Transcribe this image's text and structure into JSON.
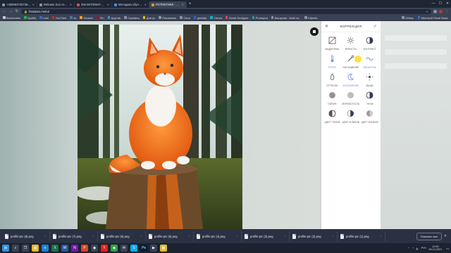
{
  "browser": {
    "tabs": [
      {
        "title": "+40696372673696742057611",
        "favicon_color": "#8a94a8",
        "active": false
      },
      {
        "title": "Release Soci release 21.12.06 (in ...",
        "favicon_color": "#8a94a8",
        "active": false
      },
      {
        "title": "305 МАТЕМАТИКА_ОЛ.pdf",
        "favicon_color": "#d9534f",
        "active": false
      },
      {
        "title": "Методика обучения математи...",
        "favicon_color": "#4a90d9",
        "active": false
      },
      {
        "title": "FOTOSTARS - Фоторедактор о...",
        "favicon_color": "#f39c12",
        "active": true
      }
    ],
    "new_tab": "+",
    "window_controls": [
      "—",
      "☐",
      "✕"
    ],
    "url": "fotostars.me/ru/"
  },
  "bookmarks": {
    "left": [
      {
        "label": "Bookmarks",
        "color": "#c8cfdb"
      },
      {
        "label": "Spotify",
        "color": "#1db954"
      },
      {
        "label": "mail",
        "color": "#2f6fdb"
      },
      {
        "label": "YouTube",
        "color": "#e62117"
      },
      {
        "label": "vk",
        "color": "#4a76a8"
      },
      {
        "label": "Scratch",
        "color": "#f7a41d"
      },
      {
        "label": "Pin",
        "color": "#bd081c"
      },
      {
        "label": "ApyLab",
        "color": "#4a90d9"
      },
      {
        "label": "Сервисы",
        "color": "#8a94a8"
      },
      {
        "label": "Для уч",
        "color": "#f1c40f"
      },
      {
        "label": "Рисование",
        "color": "#8a94a8"
      },
      {
        "label": "Своя",
        "color": "#8a94a8"
      },
      {
        "label": "genially",
        "color": "#2d62f0"
      },
      {
        "label": "Canva",
        "color": "#00c4cc"
      },
      {
        "label": "Gravit Designer",
        "color": "#e84b4b"
      },
      {
        "label": "Photopea",
        "color": "#18a497"
      },
      {
        "label": "Выгрузка - Мой на...",
        "color": "#8a94a8"
      },
      {
        "label": "Kliperts",
        "color": "#8a94a8"
      }
    ],
    "right": [
      {
        "label": "Обзор",
        "color": "#8a94a8"
      },
      {
        "label": "Microsoft Small Basic",
        "color": "#2f6fdb"
      }
    ]
  },
  "editor": {
    "panel_title": "КОРРЕКЦИЯ",
    "tools": [
      {
        "label": "ВЫДЕРЖКА",
        "icon": "exposure-icon"
      },
      {
        "label": "ЯРКОСТЬ",
        "icon": "brightness-icon"
      },
      {
        "label": "КОНТРАСТ",
        "icon": "contrast-icon"
      },
      {
        "label": "ТЕПЛО",
        "icon": "warmth-icon"
      },
      {
        "label": "НАСЫЩЕНИЕ",
        "icon": "saturation-icon"
      },
      {
        "label": "ВИНЬЕТКА",
        "icon": "vignette-icon"
      },
      {
        "label": "ОТТЕНОК",
        "icon": "tint-icon"
      },
      {
        "label": "ЗАТЕМНЕНИЕ",
        "icon": "fade-icon"
      },
      {
        "label": "ВЫЦВ",
        "icon": "sun-icon"
      },
      {
        "label": "СЕПИЯ",
        "icon": "sepia-icon"
      },
      {
        "label": "ЗЕРНИСТОСТЬ",
        "icon": "grain-icon"
      },
      {
        "label": "ТЕНИ",
        "icon": "shadows-icon"
      },
      {
        "label": "ЦВЕТ ТЕНЕЙ",
        "icon": "shadow-color-icon"
      },
      {
        "label": "ЦВЕТ БЛИКОВ",
        "icon": "highlight-color-icon"
      },
      {
        "label": "ЦВЕТ БЛИКОВ",
        "icon": "highlight-tone-icon"
      }
    ]
  },
  "downloads": {
    "items": [
      "profile-pic (8).png",
      "profile-pic (7).png",
      "profile-pic (6).png",
      "profile-pic (5).png",
      "profile-pic (4).png",
      "profile-pic (3).png",
      "profile-pic (2).png",
      "profile-pic (1).png"
    ],
    "show_all": "Показать все"
  },
  "taskbar": {
    "apps": [
      {
        "name": "windows-icon",
        "color": "#2f8fe0",
        "glyph": "⊞"
      },
      {
        "name": "search-icon",
        "color": "#3a4356",
        "glyph": "⌕"
      },
      {
        "name": "taskview-icon",
        "color": "#3a4356",
        "glyph": "❐"
      },
      {
        "name": "explorer-icon",
        "color": "#e8b630",
        "glyph": "▤"
      },
      {
        "name": "edge-icon",
        "color": "#1f7fd1",
        "glyph": "e"
      },
      {
        "name": "excel-icon",
        "color": "#1e7145",
        "glyph": "X"
      },
      {
        "name": "word-icon",
        "color": "#2b579a",
        "glyph": "W"
      },
      {
        "name": "onenote-icon",
        "color": "#7719aa",
        "glyph": "N"
      },
      {
        "name": "powerpoint-icon",
        "color": "#d24726",
        "glyph": "P"
      },
      {
        "name": "chrome-icon",
        "color": "#3a4356",
        "glyph": "◉"
      },
      {
        "name": "yandex-icon",
        "color": "#e62117",
        "glyph": "Y"
      },
      {
        "name": "chrome-alt-icon",
        "color": "#2ea043",
        "glyph": "◉"
      },
      {
        "name": "mail-icon",
        "color": "#3a4356",
        "glyph": "✉"
      },
      {
        "name": "skype-icon",
        "color": "#00aff0",
        "glyph": "S"
      },
      {
        "name": "photoshop-icon",
        "color": "#001d34",
        "glyph": "Ps"
      },
      {
        "name": "media-icon",
        "color": "#3a4356",
        "glyph": "▶"
      },
      {
        "name": "folder-icon",
        "color": "#e8b630",
        "glyph": "▦"
      }
    ],
    "lang": "РУС",
    "time": "12:50",
    "date": "08.12.2021"
  }
}
